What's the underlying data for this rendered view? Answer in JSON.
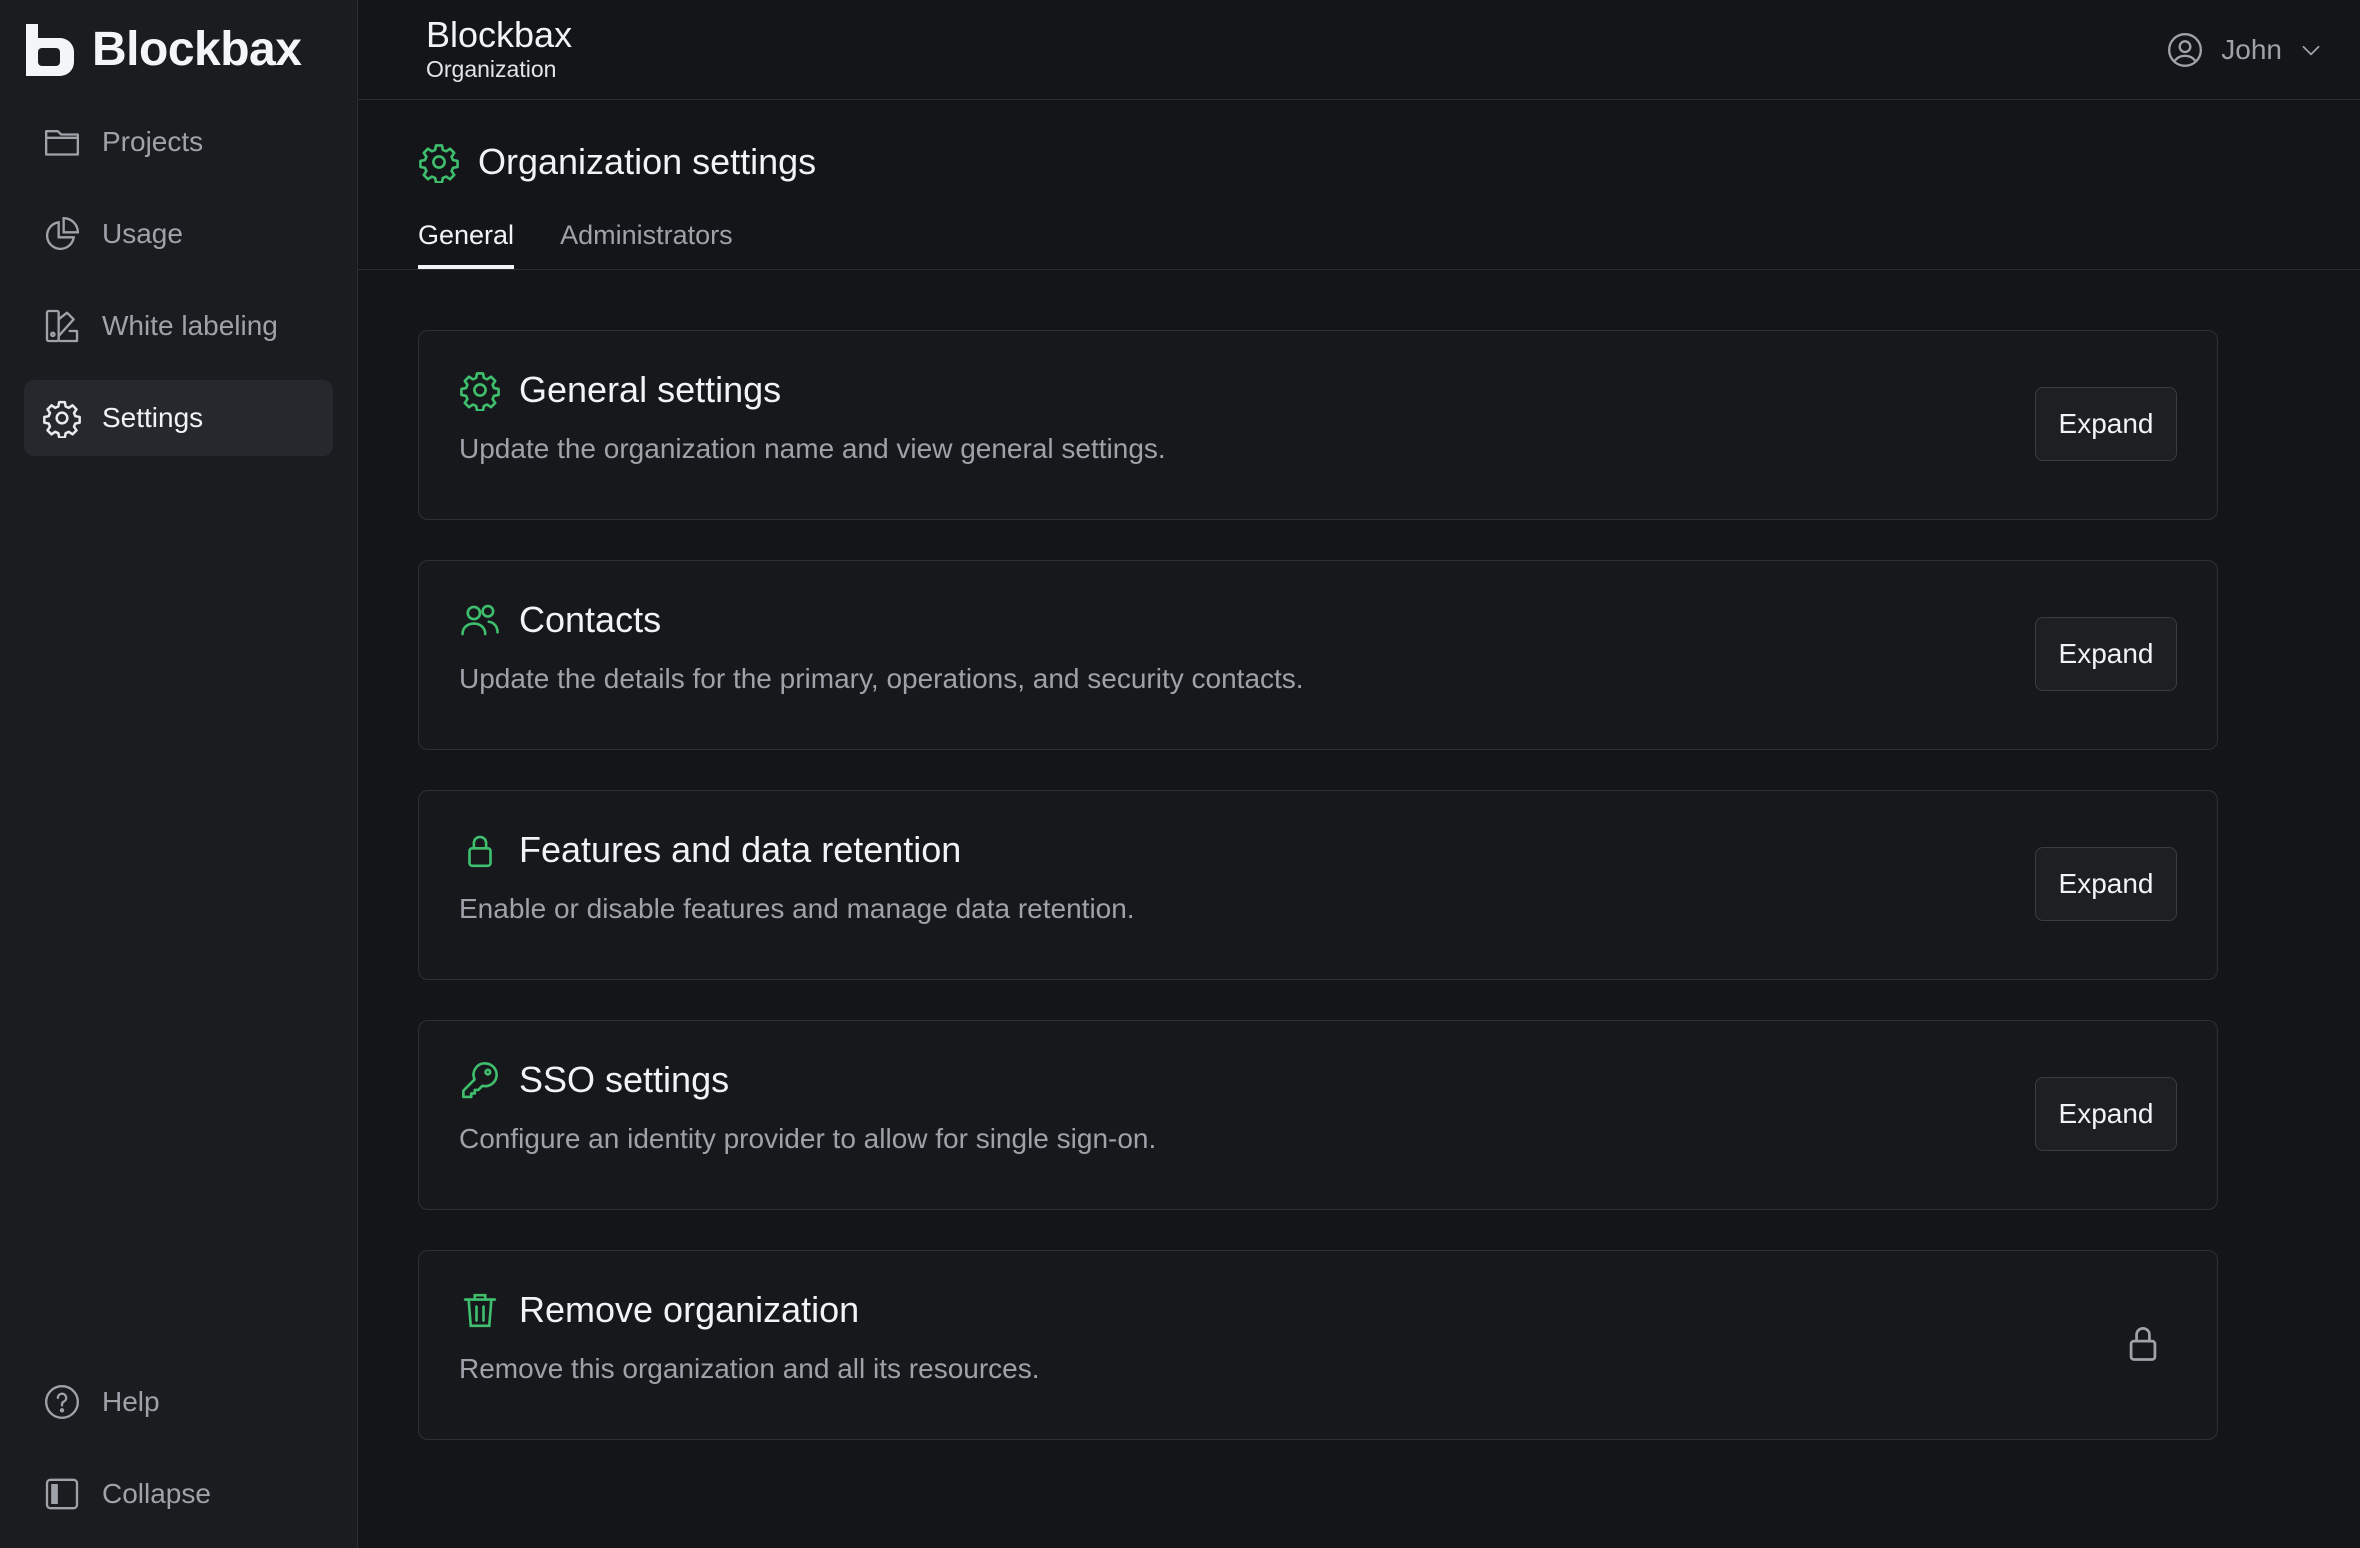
{
  "brand": {
    "name": "Blockbax",
    "accent": "#3fbf6e"
  },
  "sidebar": {
    "items": [
      {
        "label": "Projects",
        "icon": "folder-icon"
      },
      {
        "label": "Usage",
        "icon": "pie-chart-icon"
      },
      {
        "label": "White labeling",
        "icon": "palette-icon"
      },
      {
        "label": "Settings",
        "icon": "gear-icon",
        "active": true
      }
    ],
    "bottom": [
      {
        "label": "Help",
        "icon": "help-circle-icon"
      },
      {
        "label": "Collapse",
        "icon": "sidebar-collapse-icon"
      }
    ]
  },
  "header": {
    "title": "Blockbax",
    "subtitle": "Organization",
    "user": "John"
  },
  "page": {
    "title": "Organization settings",
    "tabs": [
      {
        "label": "General",
        "active": true
      },
      {
        "label": "Administrators",
        "active": false
      }
    ]
  },
  "cards": [
    {
      "title": "General settings",
      "description": "Update the organization name and view general settings.",
      "icon": "gear-icon",
      "action": "Expand"
    },
    {
      "title": "Contacts",
      "description": "Update the details for the primary, operations, and security contacts.",
      "icon": "users-icon",
      "action": "Expand"
    },
    {
      "title": "Features and data retention",
      "description": "Enable or disable features and manage data retention.",
      "icon": "lock-icon",
      "action": "Expand"
    },
    {
      "title": "SSO settings",
      "description": "Configure an identity provider to allow for single sign-on.",
      "icon": "key-icon",
      "action": "Expand"
    },
    {
      "title": "Remove organization",
      "description": "Remove this organization and all its resources.",
      "icon": "trash-icon",
      "action_icon": "lock-icon"
    }
  ]
}
